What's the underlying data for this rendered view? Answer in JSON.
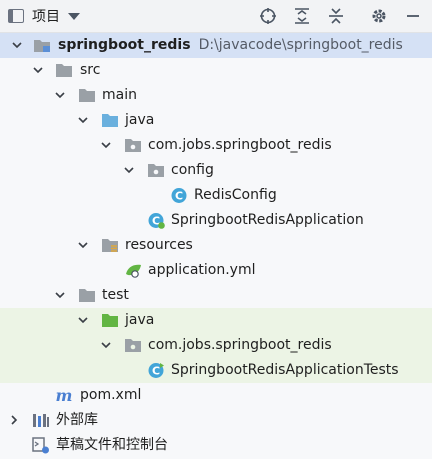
{
  "header": {
    "title": "项目"
  },
  "icons": {
    "header": [
      "crosshair-icon",
      "expand-all-icon",
      "collapse-all-icon",
      "gear-icon",
      "minimize-icon"
    ]
  },
  "tree": {
    "root": {
      "name": "springboot_redis",
      "path": "D:\\javacode\\springboot_redis"
    },
    "src": "src",
    "main": "main",
    "main_java": "java",
    "main_package": "com.jobs.springboot_redis",
    "config": "config",
    "redis_config": "RedisConfig",
    "app_class": "SpringbootRedisApplication",
    "resources": "resources",
    "app_yml": "application.yml",
    "test": "test",
    "test_java": "java",
    "test_package": "com.jobs.springboot_redis",
    "test_class": "SpringbootRedisApplicationTests",
    "pom": "pom.xml",
    "ext_libs": "外部库",
    "scratches": "草稿文件和控制台"
  },
  "colors": {
    "selection": "#d5e1f5",
    "test_highlight": "#ecf4e5",
    "folder": "#9aa0a6",
    "source_folder": "#6ab0de",
    "test_folder": "#62b543",
    "class_badge": "#42a5d8"
  }
}
